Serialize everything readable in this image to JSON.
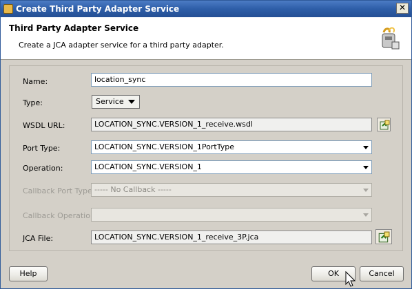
{
  "window": {
    "title": "Create Third Party Adapter Service",
    "close_glyph": "✕"
  },
  "header": {
    "title": "Third Party Adapter Service",
    "description": "Create a JCA adapter service for a third party adapter.",
    "icon": "adapter-wizard-icon"
  },
  "form": {
    "name": {
      "label": "Name:",
      "value": "location_sync"
    },
    "type": {
      "label": "Type:",
      "value": "Service"
    },
    "wsdl_url": {
      "label": "WSDL URL:",
      "value": "LOCATION_SYNC.VERSION_1_receive.wsdl"
    },
    "port_type": {
      "label": "Port Type:",
      "value": "LOCATION_SYNC.VERSION_1PortType"
    },
    "operation": {
      "label": "Operation:",
      "value": "LOCATION_SYNC.VERSION_1"
    },
    "callback_port_type": {
      "label": "Callback Port Type:",
      "value": "----- No Callback -----"
    },
    "callback_operation": {
      "label": "Callback Operation:",
      "value": ""
    },
    "jca_file": {
      "label": "JCA File:",
      "value": "LOCATION_SYNC.VERSION_1_receive_3P.jca"
    }
  },
  "buttons": {
    "help": "Help",
    "ok": "OK",
    "cancel": "Cancel"
  }
}
